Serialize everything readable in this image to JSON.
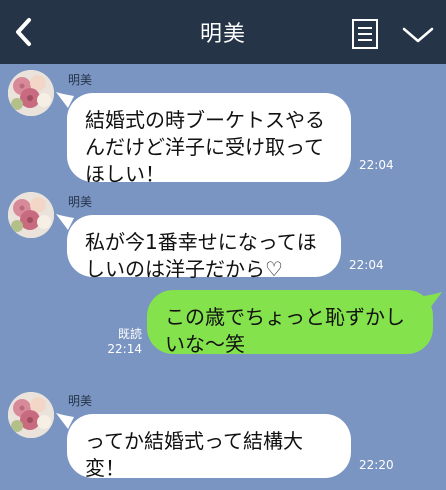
{
  "header": {
    "title": "明美"
  },
  "messages": [
    {
      "sender": "明美",
      "text": "結婚式の時ブーケトスやるんだけど洋子に受け取ってほしい！",
      "time": "22:04"
    },
    {
      "sender": "明美",
      "text": "私が今1番幸せになってほしいのは洋子だから♡",
      "time": "22:04"
    },
    {
      "text": "この歳でちょっと恥ずかしいな〜笑",
      "read": "既読",
      "time": "22:14"
    },
    {
      "sender": "明美",
      "text": "ってか結婚式って結構大変！",
      "time": "22:20"
    }
  ],
  "icons": {
    "back": "chevron-left-icon",
    "menu": "document-list-icon",
    "collapse": "chevron-down-icon"
  },
  "colors": {
    "header_bg": "#253447",
    "chat_bg": "#7b95c2",
    "incoming_bubble": "#ffffff",
    "outgoing_bubble": "#84e24c"
  }
}
